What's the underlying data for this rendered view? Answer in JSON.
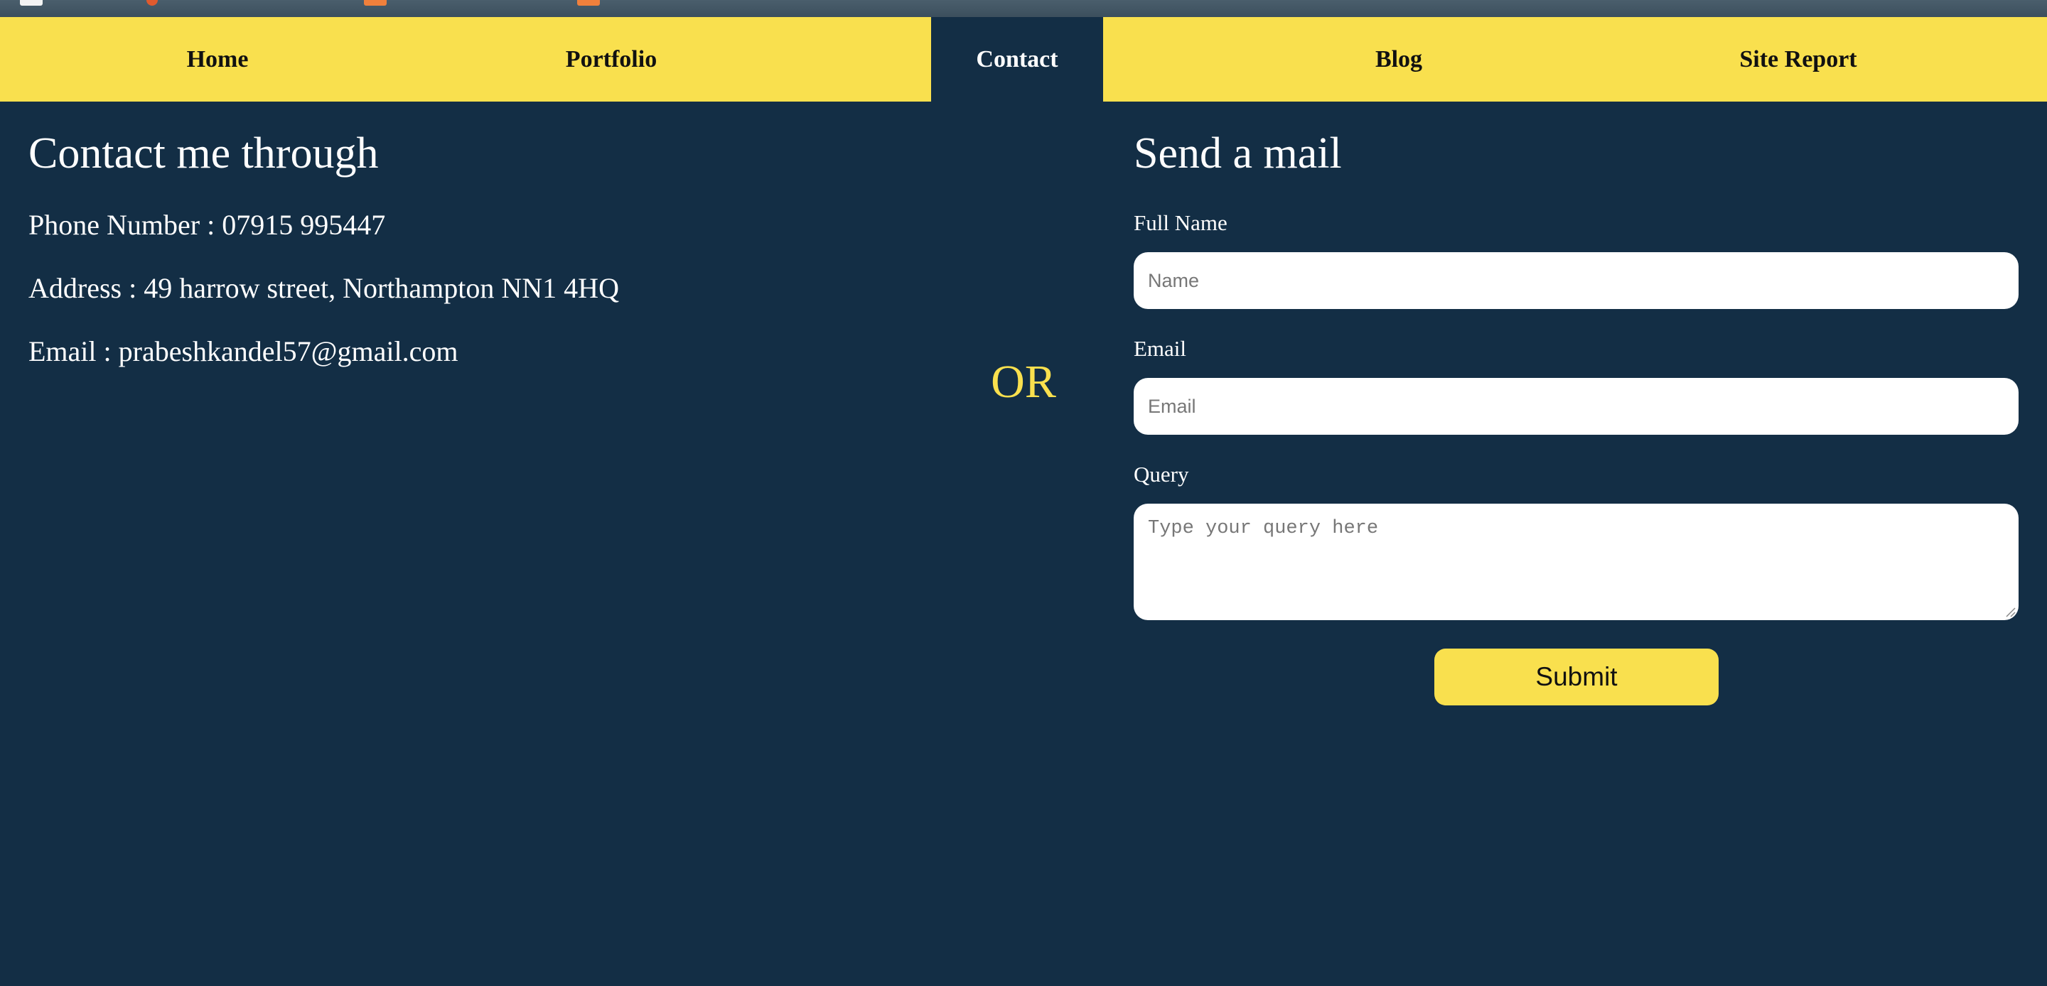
{
  "nav": {
    "items": [
      {
        "label": "Home"
      },
      {
        "label": "Portfolio"
      },
      {
        "label": "Contact"
      },
      {
        "label": "Blog"
      },
      {
        "label": "Site Report"
      }
    ],
    "active": "Contact"
  },
  "contact": {
    "title": "Contact me through",
    "phone": "Phone Number : 07915 995447",
    "address": "Address : 49 harrow street, Northampton NN1 4HQ",
    "email": "Email : prabeshkandel57@gmail.com"
  },
  "divider": {
    "text": "OR"
  },
  "mail_form": {
    "title": "Send a mail",
    "full_name_label": "Full Name",
    "full_name_placeholder": "Name",
    "email_label": "Email",
    "email_placeholder": "Email",
    "query_label": "Query",
    "query_placeholder": "Type your query here",
    "submit_label": "Submit"
  },
  "colors": {
    "background": "#132e45",
    "accent": "#f9e04e",
    "text": "#ffffff"
  }
}
